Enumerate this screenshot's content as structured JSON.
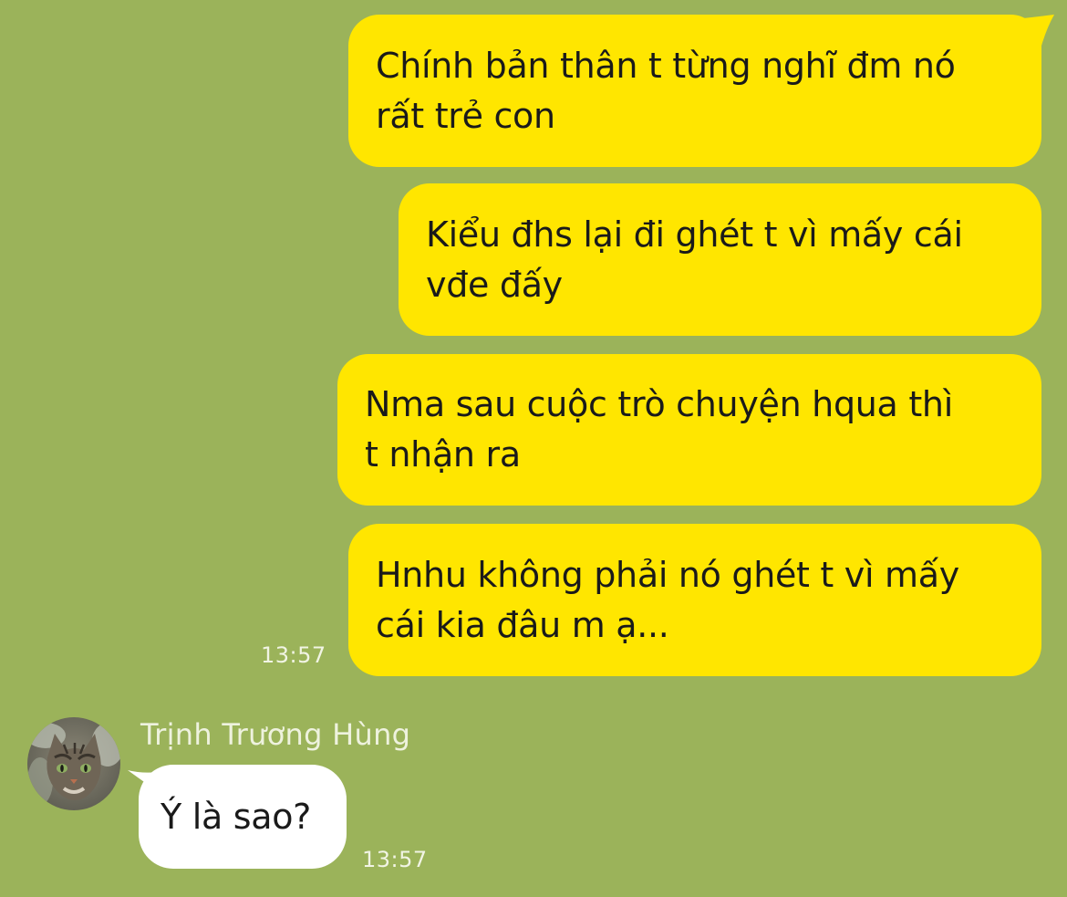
{
  "colors": {
    "background": "#9bb35a",
    "outgoing_bubble": "#ffe600",
    "incoming_bubble": "#ffffff",
    "timestamp": "#f1f4e4"
  },
  "messages_out": [
    {
      "text": "Chính bản thân t từng nghĩ đm nó\nrất trẻ con"
    },
    {
      "text": "Kiểu đhs lại đi ghét t vì mấy cái\nvđe đấy"
    },
    {
      "text": "Nma sau cuộc trò chuyện hqua thì\nt nhận ra"
    },
    {
      "text": "Hnhu không phải nó ghét t vì mấy\ncái kia đâu m ạ..."
    }
  ],
  "out_time": "13:57",
  "incoming": {
    "sender": "Trịnh Trương Hùng",
    "avatar_icon": "cat-avatar-icon",
    "text": "Ý là sao?",
    "time": "13:57"
  }
}
